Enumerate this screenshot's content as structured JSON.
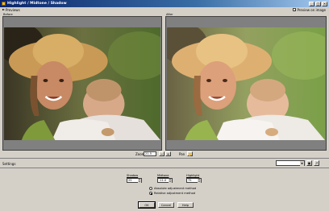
{
  "window": {
    "title": "Highlight / Midtone / Shadow",
    "controls": {
      "minimize": "_",
      "maximize": "□",
      "close": "×"
    }
  },
  "toolbar": {
    "previews_label": "Previews",
    "preview_in_image_label": "Preview on image",
    "preview_in_image_checked": true
  },
  "panels": {
    "before_label": "Before",
    "after_label": "After"
  },
  "zoom": {
    "label": "Zoom",
    "value": "21.5",
    "zoom_in": "+",
    "zoom_out": "−",
    "pan_label": "Pan"
  },
  "settings": {
    "label": "Settings",
    "preset_value": "",
    "save_icon": "save-icon",
    "load_icon": "load-icon"
  },
  "controls": {
    "shadow": {
      "label": "Shadow",
      "value": "25"
    },
    "midtone": {
      "label": "Midtone",
      "value": "-11.0"
    },
    "highlight": {
      "label": "Highlight",
      "value": "75"
    }
  },
  "method": {
    "absolute_label": "Absolute adjustment method",
    "relative_label": "Relative adjustment method",
    "selected": "relative"
  },
  "buttons": {
    "ok": "OK",
    "cancel": "Cancel",
    "help": "Help"
  }
}
